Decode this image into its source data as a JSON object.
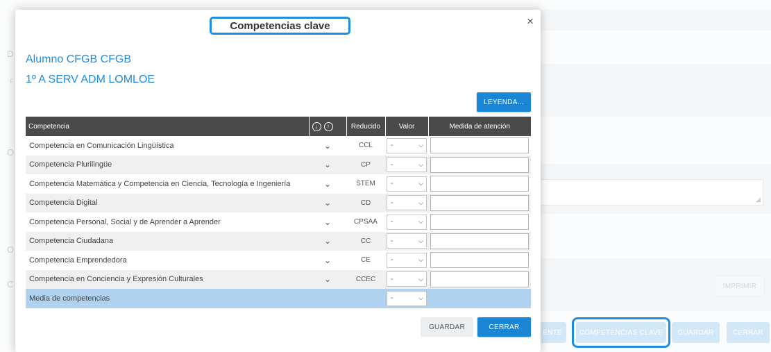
{
  "modal": {
    "title": "Competencias clave",
    "close_icon": "×",
    "student": "Alumno CFGB CFGB",
    "group": "1º A SERV ADM LOMLOE",
    "legend_button": "LEYENDA...",
    "save_button": "GUARDAR",
    "close_button": "CERRAR"
  },
  "table": {
    "headers": {
      "competencia": "Competencia",
      "reducido": "Reducido",
      "valor": "Valor",
      "medida": "Medida de atención"
    },
    "rows": [
      {
        "name": "Competencia en Comunicación Lingüística",
        "short": "CCL",
        "value": "-"
      },
      {
        "name": "Competencia Plurilingüe",
        "short": "CP",
        "value": "-"
      },
      {
        "name": "Competencia Matemática y Competencia en Ciencia, Tecnología e Ingeniería",
        "short": "STEM",
        "value": "-"
      },
      {
        "name": "Competencia Digital",
        "short": "CD",
        "value": "-"
      },
      {
        "name": "Competencia Personal, Social y de Aprender a Aprender",
        "short": "CPSAA",
        "value": "-"
      },
      {
        "name": "Competencia Ciudadana",
        "short": "CC",
        "value": "-"
      },
      {
        "name": "Competencia Emprendedora",
        "short": "CE",
        "value": "-"
      },
      {
        "name": "Competencia en Conciencia y Expresión Culturales",
        "short": "CCEC",
        "value": "-"
      }
    ],
    "average": {
      "name": "Media de competencias",
      "value": "-"
    }
  },
  "background": {
    "buttons": {
      "imprimir": "IMPRIMIR",
      "ente": "ENTE",
      "competencias": "COMPETENCIAS CLAVE",
      "guardar": "GUARDAR",
      "cerrar": "CERRAR"
    },
    "letters": [
      "D",
      "F",
      "O",
      "O",
      "C"
    ]
  },
  "colors": {
    "accent": "#1c86d6",
    "highlight": "#1c8de0",
    "header": "#4a4a4a",
    "average_row": "#b0d2ee"
  }
}
